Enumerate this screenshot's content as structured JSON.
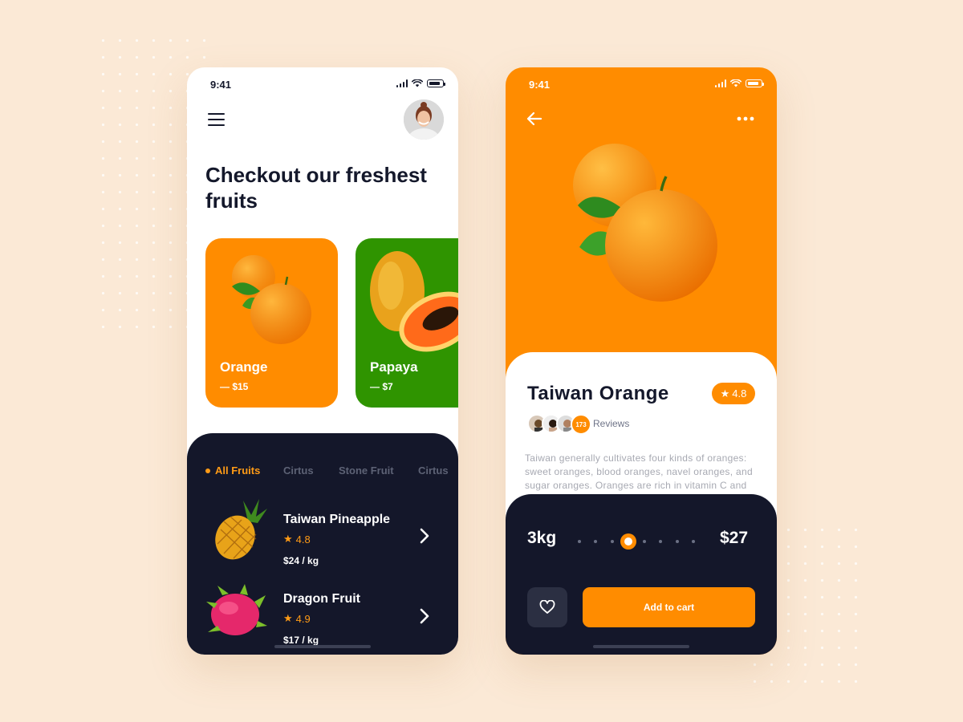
{
  "colors": {
    "background": "#fbe9d6",
    "accent_orange": "#ff8c00",
    "papaya_green": "#2f9400",
    "dark_panel": "#14172a",
    "text_dark": "#14182b"
  },
  "home_screen": {
    "status": {
      "time": "9:41"
    },
    "menu_icon": "hamburger-menu-icon",
    "headline": "Checkout our freshest fruits",
    "featured": [
      {
        "name": "Orange",
        "price": "— $15"
      },
      {
        "name": "Papaya",
        "price": "— $7"
      }
    ],
    "tabs": [
      "All Fruits",
      "Cirtus",
      "Stone Fruit",
      "Cirtus"
    ],
    "active_tab": "All Fruits",
    "products": [
      {
        "name": "Taiwan Pineapple",
        "rating": "4.8",
        "price": "$24 / kg"
      },
      {
        "name": "Dragon Fruit",
        "rating": "4.9",
        "price": "$17 / kg"
      }
    ]
  },
  "detail_screen": {
    "status": {
      "time": "9:41"
    },
    "title": "Taiwan Orange",
    "rating": "4.8",
    "review_count": "173",
    "reviews_label": "Reviews",
    "description": "Taiwan generally cultivates four kinds of oranges: sweet oranges, blood oranges, navel oranges, and sugar oranges. Oranges are rich in vitamin C and other nutrients...",
    "quantity": "3kg",
    "quantity_slider": {
      "steps": 8,
      "selected_index": 3
    },
    "total": "$27",
    "add_to_cart_label": "Add to cart"
  }
}
